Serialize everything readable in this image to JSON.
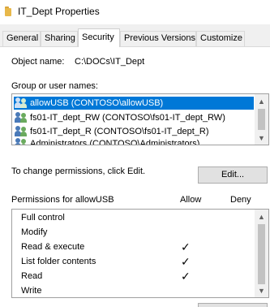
{
  "window": {
    "title": "IT_Dept Properties"
  },
  "tabs": [
    {
      "label": "General"
    },
    {
      "label": "Sharing"
    },
    {
      "label": "Security"
    },
    {
      "label": "Previous Versions"
    },
    {
      "label": "Customize"
    }
  ],
  "active_tab": "Security",
  "object": {
    "label": "Object name:",
    "value": "C:\\DOCs\\IT_Dept"
  },
  "groups": {
    "label": "Group or user names:",
    "items": [
      {
        "label": "allowUSB (CONTOSO\\allowUSB)",
        "selected": true
      },
      {
        "label": "fs01-IT_dept_RW (CONTOSO\\fs01-IT_dept_RW)",
        "selected": false
      },
      {
        "label": "fs01-IT_dept_R (CONTOSO\\fs01-IT_dept_R)",
        "selected": false
      },
      {
        "label": "Administrators (CONTOSO\\Administrators)",
        "selected": false
      }
    ]
  },
  "change_permissions": {
    "text": "To change permissions, click Edit.",
    "edit_button": "Edit..."
  },
  "permissions": {
    "header": "Permissions for allowUSB",
    "allow_label": "Allow",
    "deny_label": "Deny",
    "check_glyph": "✓",
    "rows": [
      {
        "name": "Full control",
        "allow": false,
        "deny": false
      },
      {
        "name": "Modify",
        "allow": false,
        "deny": false
      },
      {
        "name": "Read & execute",
        "allow": true,
        "deny": false
      },
      {
        "name": "List folder contents",
        "allow": true,
        "deny": false
      },
      {
        "name": "Read",
        "allow": true,
        "deny": false
      },
      {
        "name": "Write",
        "allow": false,
        "deny": false
      }
    ]
  },
  "icons": {
    "title": "folder-icon",
    "users": "group-icon",
    "scroll_up": "▲",
    "scroll_down": "▼"
  },
  "colors": {
    "selection": "#0078d7",
    "window_bg": "#f0f0f0"
  }
}
